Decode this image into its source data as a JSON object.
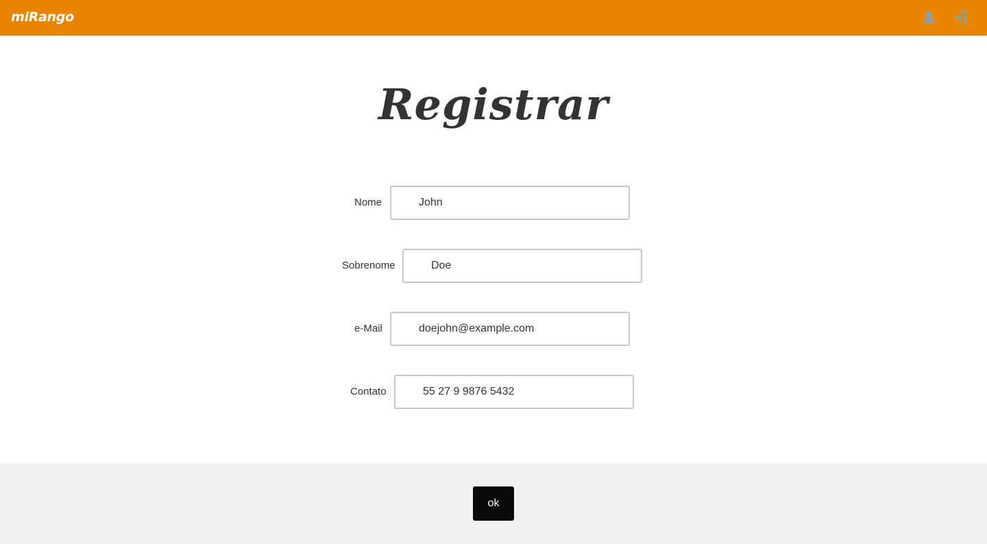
{
  "app": {
    "logo_text": "miRango",
    "brand_color": "#E88603",
    "icons": {
      "user": "user-icon",
      "login": "login-icon"
    }
  },
  "page": {
    "title": "Registrar"
  },
  "form": {
    "fields": [
      {
        "label": "Nome",
        "value": "John"
      },
      {
        "label": "Sobrenome",
        "value": "Doe"
      },
      {
        "label": "e-Mail",
        "value": "doejohn@example.com"
      },
      {
        "label": "Contato",
        "value": "55 27 9 9876 5432"
      }
    ]
  },
  "footer": {
    "ok_label": "ok",
    "button_color": "#0b0909"
  }
}
